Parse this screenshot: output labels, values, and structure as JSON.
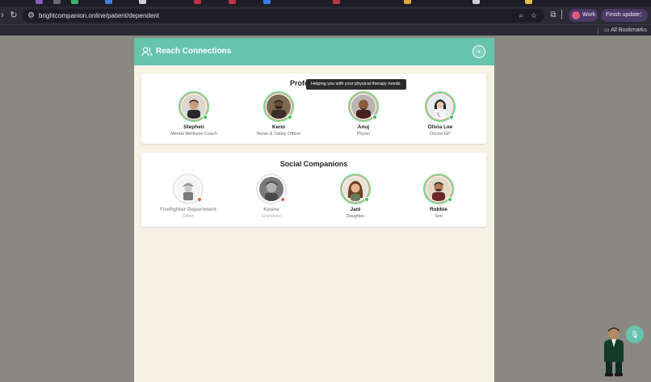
{
  "browser": {
    "url": "brightcompanion.online/patient/dependent",
    "profile_label": "Work",
    "finish_update_label": "Finish update",
    "bookmarks_label": "All Bookmarks"
  },
  "modal": {
    "title": "Reach Connections",
    "close_symbol": "×",
    "tooltip": "Helping you with your physical therapy needs."
  },
  "sections": {
    "professionals": {
      "title": "Professionals",
      "people": [
        {
          "name": "Stephen",
          "role": "Mental Wellness Coach",
          "status": "online",
          "status_color": "#3cc05a"
        },
        {
          "name": "Keno",
          "role": "Nurse & Safety Officer",
          "status": "online",
          "status_color": "#3cc05a"
        },
        {
          "name": "Anuj",
          "role": "Physio",
          "status": "online",
          "status_color": "#3cc05a"
        },
        {
          "name": "Olivia Lee",
          "role": "Doctor GP",
          "status": "online",
          "status_color": "#3cc05a"
        }
      ]
    },
    "social": {
      "title": "Social Companions",
      "people": [
        {
          "name": "Firefighter Department",
          "role": "Other",
          "status": "offline",
          "status_color": "#e35d3a"
        },
        {
          "name": "Keane",
          "role": "Grandson",
          "status": "offline",
          "status_color": "#e35d3a"
        },
        {
          "name": "Jani",
          "role": "Daughter",
          "status": "online",
          "status_color": "#3cc05a"
        },
        {
          "name": "Robbie",
          "role": "Son",
          "status": "online",
          "status_color": "#3cc05a"
        }
      ]
    }
  },
  "colors": {
    "accent": "#66c4ad",
    "modal_bg": "#f6f2e6",
    "online": "#3cc05a",
    "offline": "#e35d3a"
  },
  "icons": {
    "header": "people-icon",
    "assistant_fab": "microphone-icon"
  }
}
